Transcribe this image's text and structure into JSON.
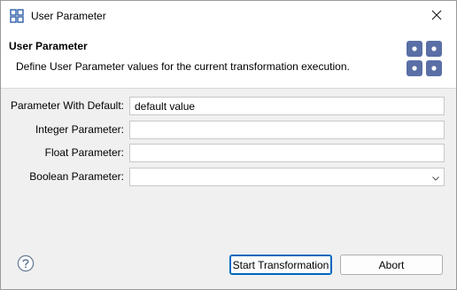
{
  "window": {
    "title": "User Parameter",
    "app_icon": "grid-icon",
    "close_icon": "close-icon"
  },
  "banner": {
    "title": "User Parameter",
    "description": "Define User Parameter values for the current transformation execution.",
    "icon": "parameter-grid-icon"
  },
  "form": {
    "fields": [
      {
        "label": "Parameter With Default:",
        "value": "default value",
        "type": "text"
      },
      {
        "label": "Integer Parameter:",
        "value": "",
        "type": "text"
      },
      {
        "label": "Float Parameter:",
        "value": "",
        "type": "text"
      },
      {
        "label": "Boolean Parameter:",
        "value": "",
        "type": "select"
      }
    ]
  },
  "footer": {
    "help_icon": "help-icon",
    "start_label": "Start Transformation",
    "abort_label": "Abort"
  },
  "colors": {
    "accent": "#0067c0",
    "icon_blue": "#5a6fa6"
  }
}
